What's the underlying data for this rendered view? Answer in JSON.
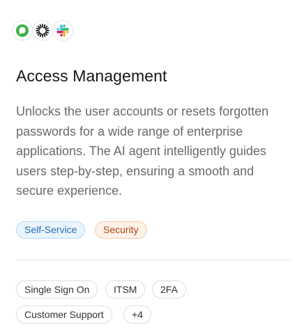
{
  "card": {
    "logos": [
      {
        "icon": "green-chat-icon",
        "color": "#3bb44a"
      },
      {
        "icon": "sunburst-icon",
        "color": "#111111"
      },
      {
        "icon": "slack-icon",
        "colors": [
          "#e01e5a",
          "#36c5f0",
          "#2eb67d",
          "#ecb22e"
        ]
      }
    ],
    "title": "Access Management",
    "description": "Unlocks the user accounts or resets forgotten passwords for a wide range of enterprise applications. The AI agent intelligently guides users step-by-step, ensuring a smooth and secure experience.",
    "categories": [
      {
        "label": "Self-Service",
        "color": "#2a6fb0"
      },
      {
        "label": "Security",
        "color": "#b24712"
      }
    ],
    "tags": [
      "Single Sign On",
      "ITSM",
      "2FA",
      "Customer Support",
      "+4"
    ]
  }
}
